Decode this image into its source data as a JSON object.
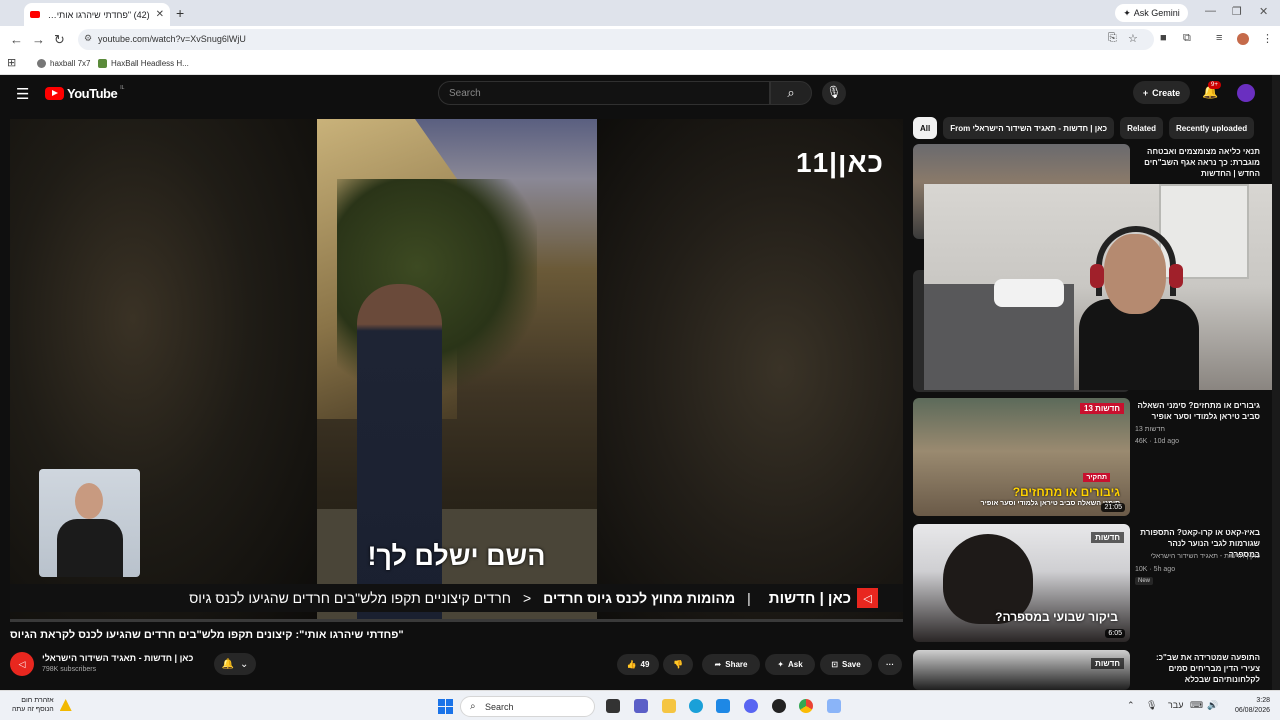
{
  "browser": {
    "tab_title": "(42) \"פחדתי שיהרגו אותי\": קיצוני",
    "tab_close": "✕",
    "new_tab": "+",
    "ask_gemini": "Ask Gemini",
    "url": "youtube.com/watch?v=XvSnug6lWjU",
    "bookmarks": [
      "haxball 7x7",
      "HaxBall Headless H..."
    ]
  },
  "youtube": {
    "logo_text": "YouTube",
    "logo_country": "IL",
    "search_placeholder": "Search",
    "create_label": "Create",
    "notif_count": "9+"
  },
  "player": {
    "channel_bug": "כאן|11",
    "subtitle": "השם ישלם לך!",
    "ticker": {
      "brand": "כאן | חדשות",
      "headline": "מהומות מחוץ לכנס גיוס חרדים",
      "text": "חרדים קיצוניים תקפו מלש\"בים חרדים שהגיעו לכנס גיוס"
    }
  },
  "video": {
    "title": "\"פחדתי שיהרגו אותי\": קיצונים תקפו מלש\"בים חרדים שהגיעו לכנס לקראת הגיוס",
    "channel_name": "כאן | חדשות - תאגיד השידור הישראלי",
    "subscribers": "798K subscribers",
    "likes": "49",
    "share_label": "Share",
    "ask_label": "Ask",
    "save_label": "Save",
    "more": "···"
  },
  "sidebar": {
    "chips": [
      "All",
      "From כאן | חדשות - תאגיד השידור הישראלי",
      "Related",
      "Recently uploaded"
    ],
    "items": [
      {
        "title": "תנאי כליאה מצומצמים ואבטחה מוגברת: כך נראה אגף השב\"חים החדש | החדשות",
        "channel": "",
        "meta": "",
        "duration": ""
      },
      {
        "title": "גיבורים או מתחזים? סימני השאלה סביב טיראן גלמודי וסער אופיר",
        "channel": "חדשות 13",
        "meta": "46K · 10d ago",
        "duration": "21:05",
        "thumb_text": "גיבורים או מתחזים?",
        "thumb_sub": "סימני השאלה סביב טיראן גלמודי וסער אופיר",
        "thumb_tag": "תחקיר",
        "thumb_brand": "חדשות 13"
      },
      {
        "title": "באיז-קאט או קרו-קאט? התספורת שגורמות לגבי הנוער לנהר במספרה",
        "channel": "כאן | חדשות - תאגיד השידור הישראלי",
        "meta": "10K · 5h ago",
        "badge": "New",
        "duration": "6:05",
        "thumb_text": "ביקור שבועי במספרה?",
        "thumb_brand": "חדשות"
      },
      {
        "title": "התופעה שמטרידה את שב\"כ: צעירי הדין מבריחים סמים לקלחונותיהם שבכלא",
        "channel": "",
        "meta": "",
        "duration": "",
        "thumb_brand": "חדשות"
      }
    ]
  },
  "taskbar": {
    "weather_line1": "אזהרת חום",
    "weather_line2": "הנוסף זה עתה",
    "search_placeholder": "Search",
    "lang": "עבר",
    "time": "3:28",
    "date": "06/08/2026"
  }
}
